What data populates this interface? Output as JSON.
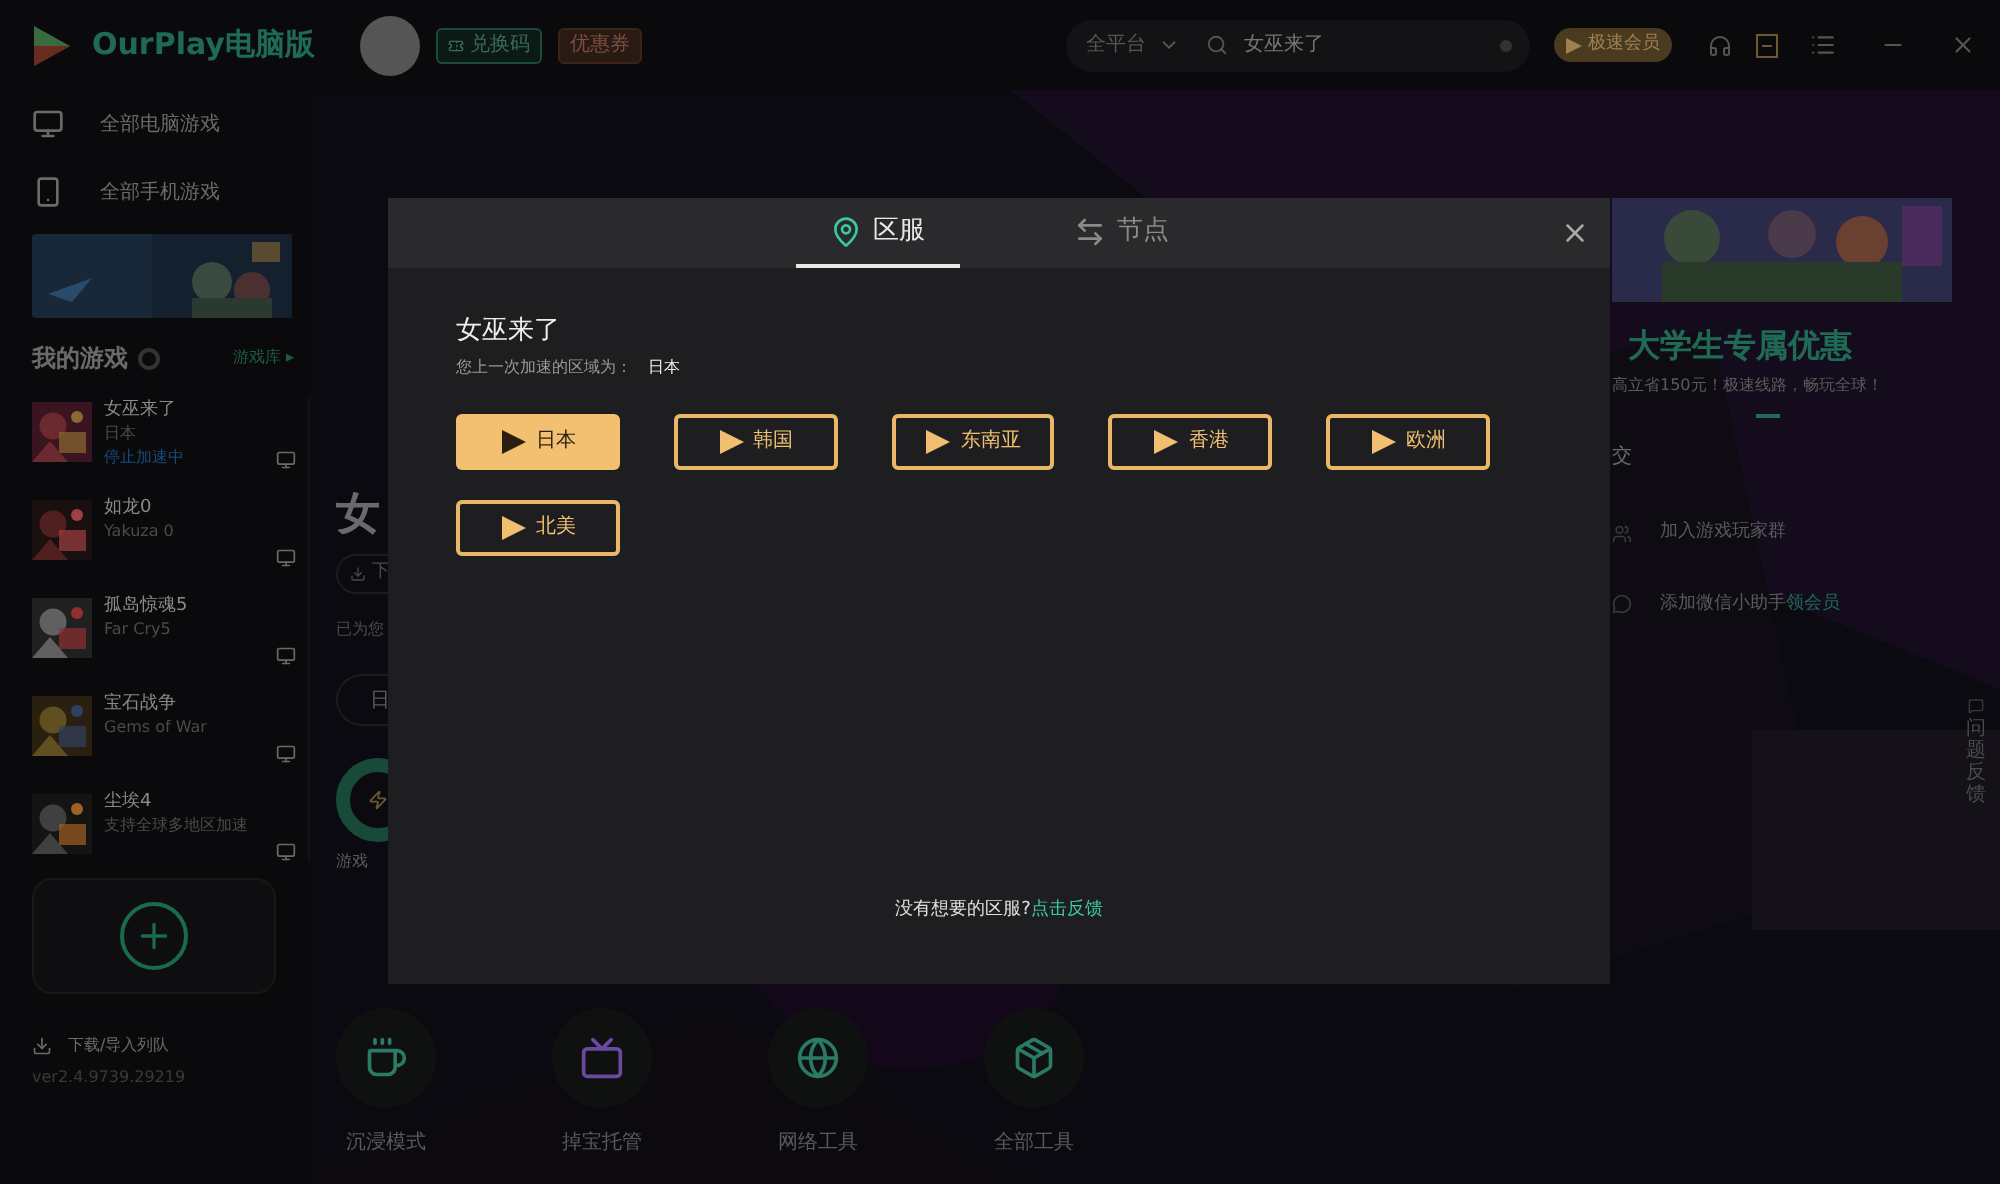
{
  "app": {
    "title": "OurPlay电脑版"
  },
  "header": {
    "badges": [
      {
        "label": "兑换码",
        "kind": "redeem"
      },
      {
        "label": "优惠券",
        "kind": "coupon"
      }
    ],
    "platform": "全平台",
    "search_value": "女巫来了",
    "vip_button": "极速会员"
  },
  "sidebar": {
    "nav": [
      {
        "label": "全部电脑游戏",
        "kind": "pc"
      },
      {
        "label": "全部手机游戏",
        "kind": "mobile"
      }
    ],
    "my_games_title": "我的游戏",
    "library_link": "游戏库 ▸",
    "games": [
      {
        "name": "女巫来了",
        "subtitle": "日本",
        "status": "停止加速中"
      },
      {
        "name": "如龙0",
        "subtitle": "Yakuza 0"
      },
      {
        "name": "孤岛惊魂5",
        "subtitle": "Far Cry5"
      },
      {
        "name": "宝石战争",
        "subtitle": "Gems of War"
      },
      {
        "name": "尘埃4",
        "subtitle": "支持全球多地区加速"
      }
    ],
    "download_queue": "下载/导入列队",
    "version": "ver2.4.9739.29219"
  },
  "main": {
    "title_fragment": "女",
    "download_fragment": "下",
    "note_fragment": "已为您",
    "region_fragment": "日",
    "boost_fragment": "游戏",
    "tools": [
      {
        "label": "沉浸模式",
        "kind": "cup"
      },
      {
        "label": "掉宝托管",
        "kind": "twitch"
      },
      {
        "label": "网络工具",
        "kind": "globe"
      },
      {
        "label": "全部工具",
        "kind": "box"
      }
    ],
    "promo": {
      "title": "大学生专属优惠",
      "subtitle": "高立省150元！极速线路，畅玩全球！"
    },
    "social_title": "交",
    "social": [
      {
        "text": "加入游戏玩家群"
      },
      {
        "text": "添加微信小助手",
        "link": "领会员"
      }
    ],
    "feedback": "问题反馈"
  },
  "modal": {
    "tabs": [
      {
        "label": "区服",
        "kind": "region",
        "selected": true
      },
      {
        "label": "节点",
        "kind": "node",
        "selected": false
      }
    ],
    "game": "女巫来了",
    "last_label": "您上一次加速的区域为：",
    "last_value": "日本",
    "regions": [
      {
        "label": "日本",
        "selected": true
      },
      {
        "label": "韩国",
        "selected": false
      },
      {
        "label": "东南亚",
        "selected": false
      },
      {
        "label": "香港",
        "selected": false
      },
      {
        "label": "欧洲",
        "selected": false
      },
      {
        "label": "北美",
        "selected": false
      }
    ],
    "footer": "没有想要的区服?",
    "footer_link": "点击反馈"
  }
}
